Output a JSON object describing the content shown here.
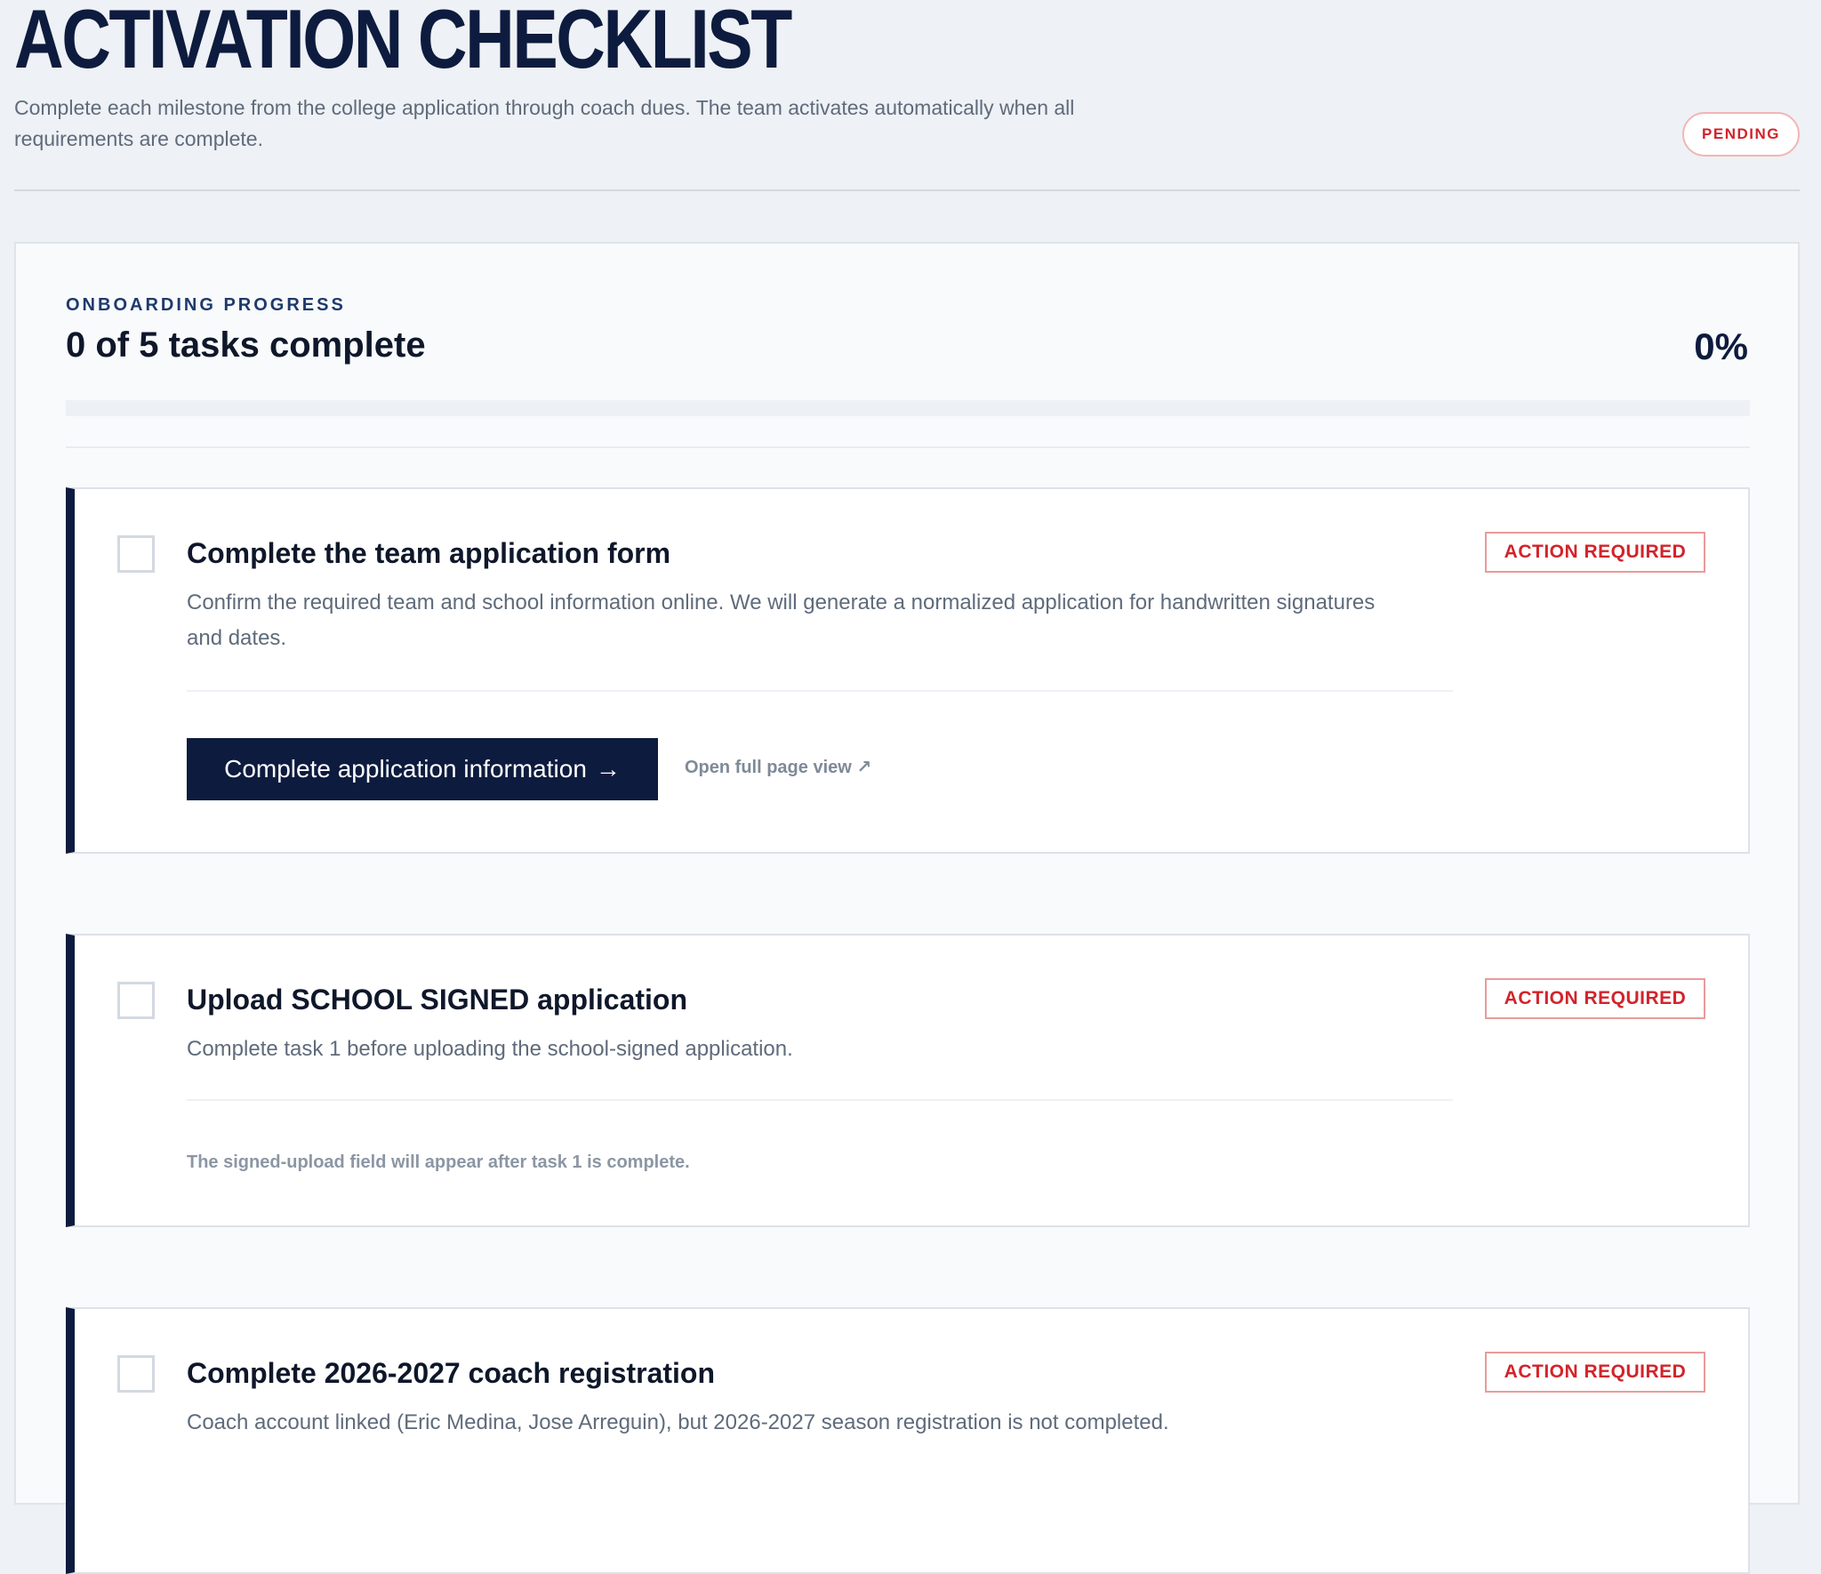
{
  "header": {
    "title": "ACTIVATION CHECKLIST",
    "subtitle": "Complete each milestone from the college application through coach dues. The team activates automatically when all requirements are complete.",
    "status": "PENDING"
  },
  "progress": {
    "eyebrow": "ONBOARDING PROGRESS",
    "summary": "0 of 5 tasks complete",
    "percent_label": "0%",
    "fraction": 0
  },
  "tasks": [
    {
      "title": "Complete the team application form",
      "description": "Confirm the required team and school information online. We will generate a normalized application for handwritten signatures and dates.",
      "badge": "ACTION REQUIRED",
      "primary_action": "Complete application information",
      "primary_arrow": "→",
      "secondary_link": "Open full page view ↗"
    },
    {
      "title": "Upload SCHOOL SIGNED application",
      "description": "Complete task 1 before uploading the school-signed application.",
      "badge": "ACTION REQUIRED",
      "note": "The signed-upload field will appear after task 1 is complete."
    },
    {
      "title": "Complete 2026-2027 coach registration",
      "description": "Coach account linked (Eric Medina, Jose Arreguin), but 2026-2027 season registration is not completed.",
      "badge": "ACTION REQUIRED"
    }
  ],
  "colors": {
    "accent": "#0d1b3e",
    "danger": "#d3232a",
    "background": "#eef1f5"
  }
}
